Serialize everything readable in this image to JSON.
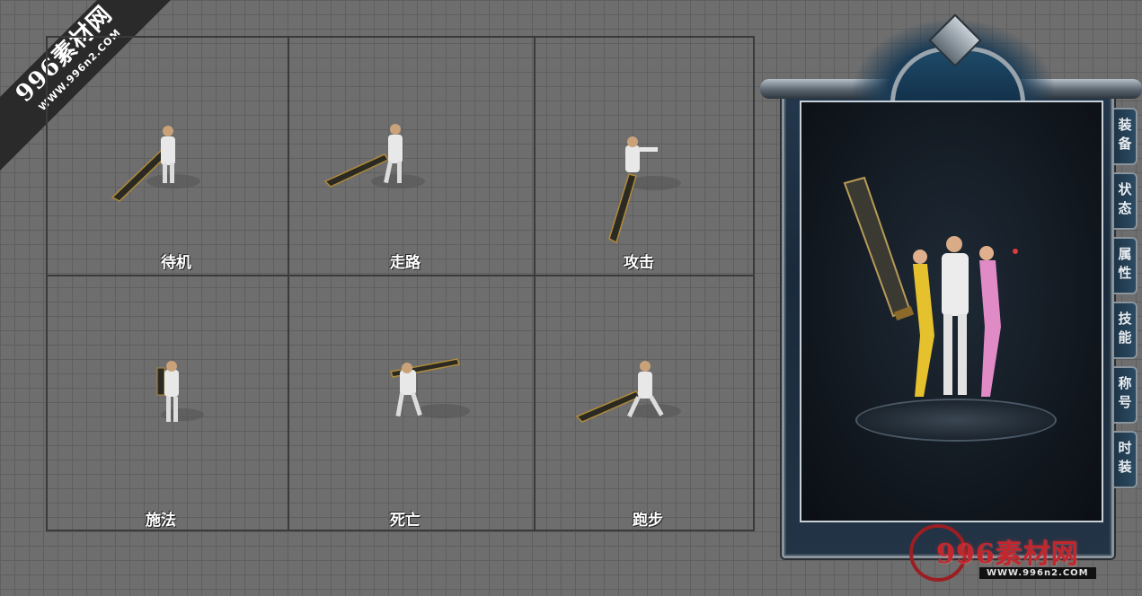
{
  "watermark": {
    "main": "996素材网",
    "url": "WWW.996n2.COM"
  },
  "animations": [
    {
      "label": "待机"
    },
    {
      "label": "走路"
    },
    {
      "label": "攻击"
    },
    {
      "label": "施法"
    },
    {
      "label": "死亡"
    },
    {
      "label": "跑步"
    }
  ],
  "panel": {
    "tabs": [
      "装备",
      "状态",
      "属性",
      "技能",
      "称号",
      "时装"
    ],
    "logo_text": "996素材网",
    "logo_url": "WWW.996n2.COM"
  }
}
